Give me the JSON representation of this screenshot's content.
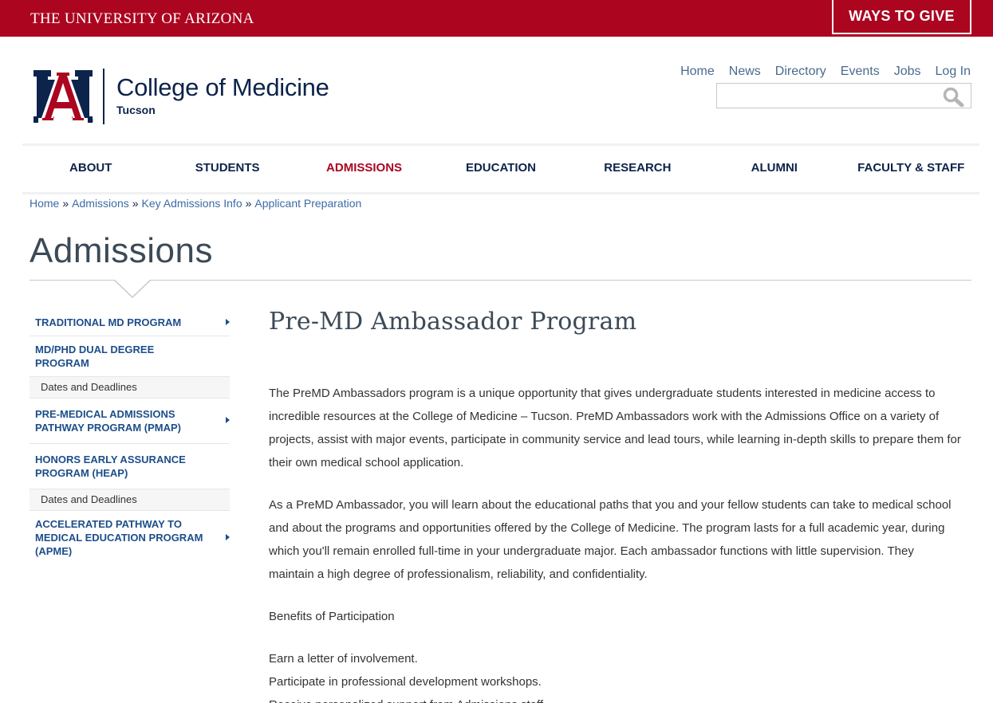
{
  "topbar": {
    "wordmark": "THE UNIVERSITY OF ARIZONA",
    "give_button": "WAYS TO GIVE",
    "color": "#ab0520"
  },
  "logo": {
    "title": "College of Medicine",
    "subtitle": "Tucson"
  },
  "utility_nav": [
    "Home",
    "News",
    "Directory",
    "Events",
    "Jobs",
    "Log In"
  ],
  "search": {
    "placeholder": "",
    "icon": "search-icon"
  },
  "main_nav": [
    {
      "label": "ABOUT",
      "active": false
    },
    {
      "label": "STUDENTS",
      "active": false
    },
    {
      "label": "ADMISSIONS",
      "active": true
    },
    {
      "label": "EDUCATION",
      "active": false
    },
    {
      "label": "RESEARCH",
      "active": false
    },
    {
      "label": "ALUMNI",
      "active": false
    },
    {
      "label": "FACULTY & STAFF",
      "active": false
    }
  ],
  "breadcrumb": [
    "Home",
    "Admissions",
    "Key Admissions Info",
    "Applicant Preparation"
  ],
  "page_title": "Admissions",
  "sidebar": [
    {
      "label": "TRADITIONAL MD PROGRAM",
      "has_arrow": true
    },
    {
      "label": "MD/PHD DUAL DEGREE PROGRAM",
      "has_arrow": false
    },
    {
      "label": "Dates and Deadlines",
      "sub": true
    },
    {
      "label": "PRE-MEDICAL ADMISSIONS PATHWAY PROGRAM (PMAP)",
      "has_arrow": true
    },
    {
      "label": "HONORS EARLY ASSURANCE PROGRAM (HEAP)",
      "has_arrow": false
    },
    {
      "label": "Dates and Deadlines",
      "sub": true
    },
    {
      "label": "ACCELERATED PATHWAY TO MEDICAL EDUCATION PROGRAM (APME)",
      "has_arrow": true
    }
  ],
  "content": {
    "heading": "Pre-MD Ambassador Program",
    "paragraphs": [
      "The PreMD Ambassadors program is a unique opportunity that gives undergraduate students interested in medicine access to incredible resources at the College of Medicine – Tucson. PreMD Ambassadors work with the Admissions Office on a variety of projects, assist with major events, participate in community service and lead tours, while learning in-depth skills to prepare them for their own medical school application.",
      "As a PreMD Ambassador, you will learn about the educational paths that you and your fellow students can take to medical school and about the programs and opportunities offered by the College of Medicine. The program lasts for a full academic year, during which you'll remain enrolled full-time in your undergraduate major. Each ambassador functions with little supervision. They maintain a high degree of professionalism, reliability, and confidentiality.",
      "Benefits of Participation"
    ],
    "benefits": [
      "Earn a letter of involvement.",
      "Participate in professional development workshops.",
      "Receive personalized support from Admissions staff."
    ]
  }
}
